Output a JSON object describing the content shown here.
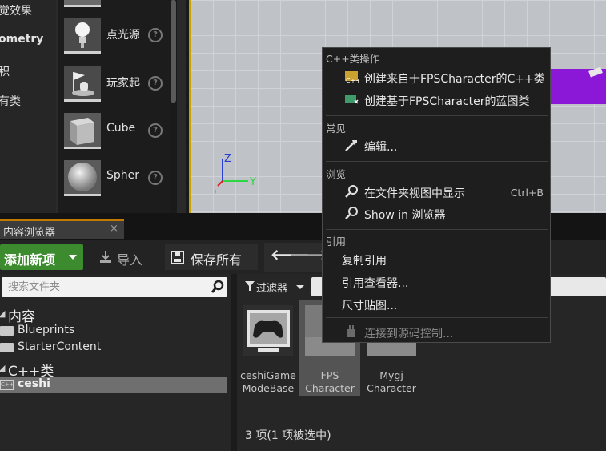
{
  "modes_panel": {
    "categories": [
      {
        "label": "觉效果"
      },
      {
        "label": "ometry"
      },
      {
        "label": "积"
      },
      {
        "label": "有类"
      }
    ],
    "assets": [
      {
        "label": "点光源"
      },
      {
        "label": "玩家起"
      },
      {
        "label": "Cube"
      },
      {
        "label": "Spher"
      }
    ]
  },
  "viewport": {
    "gizmo_z": "Z",
    "gizmo_y": "Y",
    "gizmo_x": "X"
  },
  "content_browser": {
    "tab_label": "内容浏览器",
    "tab_close": "×",
    "toolbar": {
      "add_new": "添加新项",
      "import": "导入",
      "save_all": "保存所有",
      "back": "🡐",
      "forward": "🡒"
    },
    "sources": {
      "search_placeholder": "搜索文件夹",
      "tree": [
        {
          "label": "内容"
        },
        {
          "label": "Blueprints"
        },
        {
          "label": "StarterContent"
        },
        {
          "label": "C++类"
        },
        {
          "label": "ceshi"
        }
      ]
    },
    "filters_label": "过滤器",
    "assets": [
      {
        "line1": "ceshiGame",
        "line2": "ModeBase"
      },
      {
        "line1": "FPS",
        "line2": "Character"
      },
      {
        "line1": "Mygj",
        "line2": "Character"
      }
    ],
    "status": "3 项(1 项被选中)"
  },
  "context_menu": {
    "sections": [
      {
        "header": "C++类操作",
        "items": [
          {
            "label": "创建来自于FPSCharacter的C++类",
            "shortcut": ""
          },
          {
            "label": "创建基于FPSCharacter的蓝图类",
            "shortcut": ""
          }
        ]
      },
      {
        "header": "常见",
        "items": [
          {
            "label": "编辑...",
            "shortcut": ""
          }
        ]
      },
      {
        "header": "浏览",
        "items": [
          {
            "label": "在文件夹视图中显示",
            "shortcut": "Ctrl+B"
          },
          {
            "label": "Show in 浏览器",
            "shortcut": ""
          }
        ]
      },
      {
        "header": "引用",
        "items": [
          {
            "label": "复制引用",
            "shortcut": ""
          },
          {
            "label": "引用查看器...",
            "shortcut": ""
          },
          {
            "label": "尺寸贴图...",
            "shortcut": ""
          },
          {
            "label": "连接到源码控制...",
            "shortcut": ""
          }
        ]
      }
    ]
  },
  "colors": {
    "accent_orange": "#c07a00",
    "add_new_green": "#3c8b2e",
    "viewport_border": "#c8a200",
    "floor_purple": "#8a18d6"
  }
}
